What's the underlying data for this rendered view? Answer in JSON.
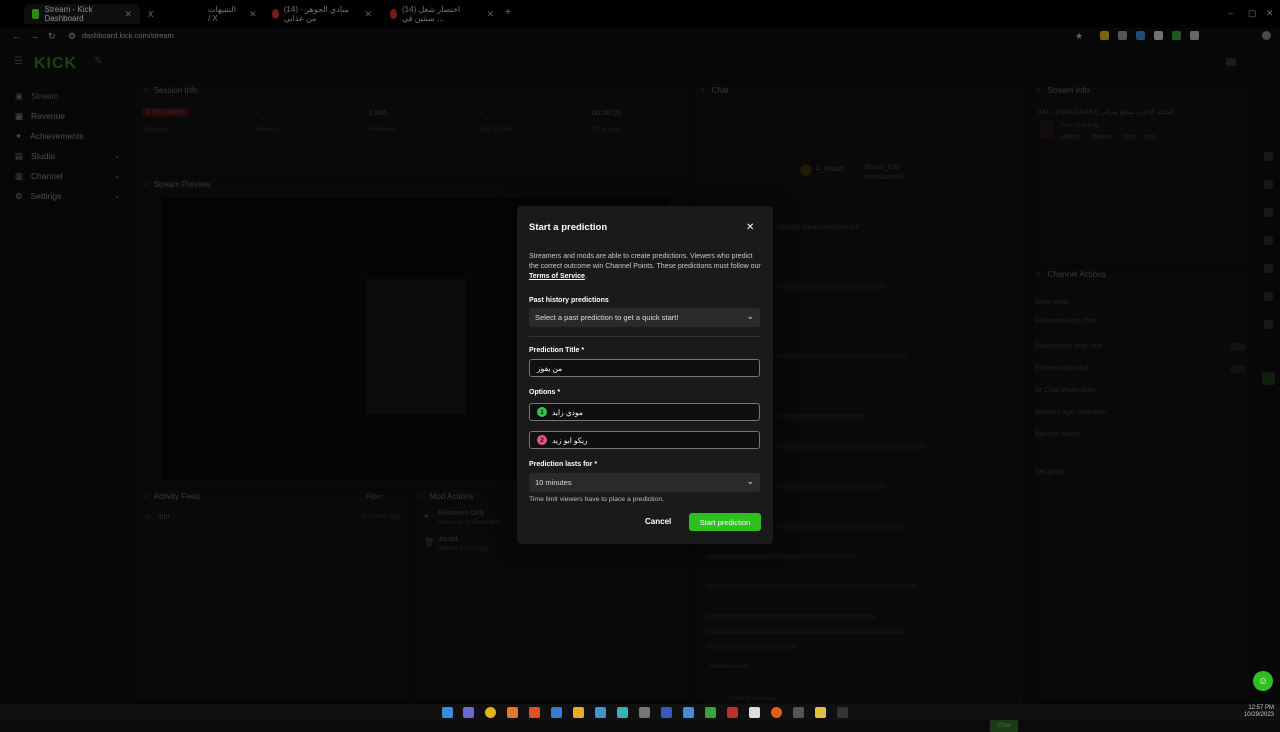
{
  "browser": {
    "tabs": [
      {
        "label": "Stream - Kick Dashboard",
        "active": true
      },
      {
        "label": "X",
        "active": false
      },
      {
        "label": "التنبيهات / X",
        "active": false
      },
      {
        "label": "(14) مبادي الجوهر - من عذابي",
        "active": false
      },
      {
        "label": "(14) اختصار شغل سنتين في ...",
        "active": false
      }
    ],
    "url": "dashboard.kick.com/stream"
  },
  "app": {
    "logo": "KICK",
    "sidebar": [
      {
        "label": "Stream",
        "chev": ""
      },
      {
        "label": "Revenue",
        "chev": ""
      },
      {
        "label": "Achievements",
        "chev": ""
      },
      {
        "label": "Studio",
        "chev": "⌄"
      },
      {
        "label": "Channel",
        "chev": "⌄"
      },
      {
        "label": "Settings",
        "chev": "⌄"
      }
    ],
    "session_info": {
      "title": "Session Info",
      "badge": "STREAMING",
      "stats": [
        {
          "value": "",
          "label": "Session"
        },
        {
          "value": "-",
          "label": "Viewers"
        },
        {
          "value": "3,345",
          "label": "Followers"
        },
        {
          "value": "-",
          "label": "Sub Counts"
        },
        {
          "value": "00:08:01",
          "label": "Time Live"
        }
      ]
    },
    "stream_preview": {
      "title": "Stream Preview"
    },
    "activity_feed": {
      "title": "Activity Feed",
      "filter": "Filter",
      "user": "ihbr",
      "time": "4 minutes ago"
    },
    "mod_actions": {
      "title": "Mod Actions",
      "items": [
        {
          "title": "Followers-Only",
          "sub": "turned on by Mahmdi12"
        },
        {
          "title": "illaseiL",
          "sub": "deleted a message"
        }
      ]
    },
    "chat": {
      "title": "Chat",
      "pinned_link": "https://tip.dokan.sa/mghmd12",
      "input_placeholder": "Send a message",
      "send_label": "Chat",
      "followers_only": "Followers only",
      "users": [
        "A_Muath",
        "3bood_83d",
        "mamdouhM2"
      ]
    },
    "stream_info": {
      "title": "Stream Info",
      "stream_title": "IMT⇔[YAKUZA]4K7] الحلقة الاخيرة مقطع شرقي",
      "category": "Just Chatting",
      "tags": [
        "Arabic",
        "Yakuza",
        "kss",
        "rel"
      ]
    },
    "channel_actions": {
      "title": "Channel Actions",
      "items": [
        "Slow mode",
        "Followers-only chat",
        "Subscribers-only chat",
        "Emotes-only chat",
        "AI Chat Moderation",
        "Account age restriction",
        "Banned words",
        "Set goals"
      ]
    }
  },
  "modal": {
    "title": "Start a prediction",
    "description": "Streamers and mods are able to create predictions. Viewers who predict the correct outcome win Channel Points. These predictions must follow our",
    "tos": "Terms of Service",
    "past_label": "Past history predictions",
    "past_placeholder": "Select a past prediction to get a quick start!",
    "title_label": "Prediction Title *",
    "title_value": "من يفوز",
    "options_label": "Options *",
    "options": [
      {
        "num": "1",
        "value": "مودي زايد",
        "color": "#34c44a"
      },
      {
        "num": "2",
        "value": "ريكو ابو زيد",
        "color": "#e0567a"
      }
    ],
    "duration_label": "Prediction lasts for *",
    "duration_value": "10 minutes",
    "duration_hint": "Time limit viewers have to place a prediction.",
    "cancel": "Cancel",
    "start": "Start prediction"
  },
  "taskbar": {
    "time": "12:57 PM",
    "date": "10/29/2023"
  },
  "colors": {
    "accent": "#2fbf23",
    "modal_bg": "#1a1a1b",
    "streaming_badge": "#e23b3b"
  }
}
